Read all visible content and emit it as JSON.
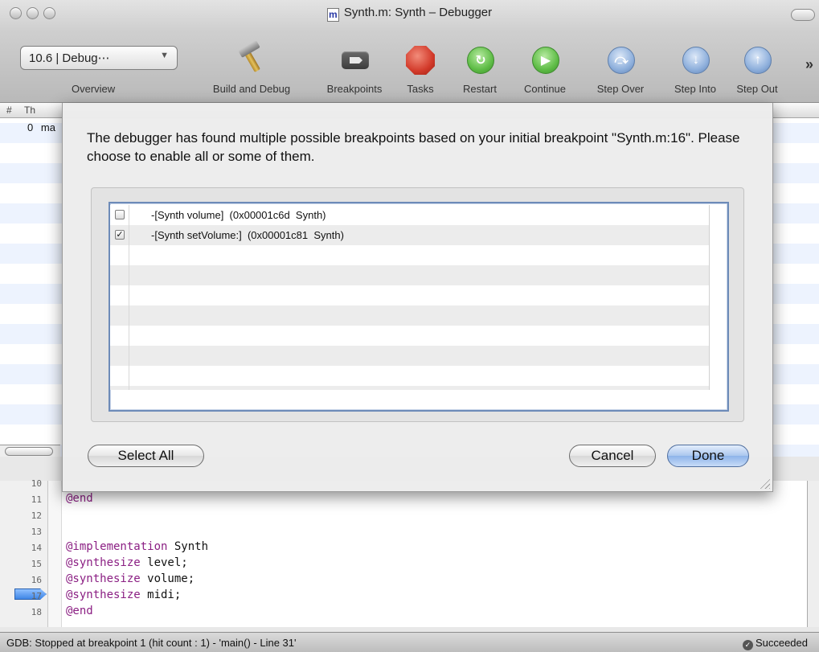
{
  "window": {
    "title": "Synth.m: Synth – Debugger",
    "doc_icon": "m"
  },
  "toolbar": {
    "scheme_value": "10.6 | Debug⋯",
    "overview_label": "Overview",
    "buttons": [
      {
        "label": "Build and Debug",
        "icon": "hammer-icon"
      },
      {
        "label": "Breakpoints",
        "icon": "breakpoint-icon"
      },
      {
        "label": "Tasks",
        "icon": "stop-icon"
      },
      {
        "label": "Restart",
        "icon": "restart-icon"
      },
      {
        "label": "Continue",
        "icon": "continue-icon"
      },
      {
        "label": "Step Over",
        "icon": "step-over-icon"
      },
      {
        "label": "Step Into",
        "icon": "step-into-icon"
      },
      {
        "label": "Step Out",
        "icon": "step-out-icon"
      }
    ],
    "overflow": "»"
  },
  "background": {
    "stack_header_hash": "#",
    "stack_header_thread": "Th",
    "stack_row_num": "0",
    "stack_row_name": "ma"
  },
  "sheet": {
    "message": "The debugger has found multiple possible breakpoints based on your initial breakpoint \"Synth.m:16\". Please choose to enable all or some of them.",
    "options": [
      {
        "checked": false,
        "label": "-[Synth volume]  (0x00001c6d  Synth)"
      },
      {
        "checked": true,
        "label": "-[Synth setVolume:]  (0x00001c81  Synth)"
      }
    ],
    "select_all": "Select All",
    "cancel": "Cancel",
    "done": "Done"
  },
  "editor": {
    "lines": [
      {
        "num": "10",
        "parts": [
          {
            "t": "",
            "kw": false
          }
        ]
      },
      {
        "num": "11",
        "parts": [
          {
            "t": "@end",
            "kw": true
          }
        ]
      },
      {
        "num": "12",
        "parts": []
      },
      {
        "num": "13",
        "parts": []
      },
      {
        "num": "14",
        "parts": [
          {
            "t": "@implementation",
            "kw": true
          },
          {
            "t": " Synth",
            "kw": false
          }
        ]
      },
      {
        "num": "15",
        "parts": [
          {
            "t": "@synthesize",
            "kw": true
          },
          {
            "t": " level;",
            "kw": false
          }
        ]
      },
      {
        "num": "16",
        "parts": [
          {
            "t": "@synthesize",
            "kw": true
          },
          {
            "t": " volume;",
            "kw": false
          }
        ]
      },
      {
        "num": "17",
        "parts": [
          {
            "t": "@synthesize",
            "kw": true
          },
          {
            "t": " midi;",
            "kw": false
          }
        ]
      },
      {
        "num": "18",
        "parts": [
          {
            "t": "@end",
            "kw": true
          }
        ]
      }
    ]
  },
  "status": {
    "message": "GDB: Stopped at breakpoint 1 (hit count : 1) - 'main() - Line 31'",
    "result": "Succeeded"
  }
}
